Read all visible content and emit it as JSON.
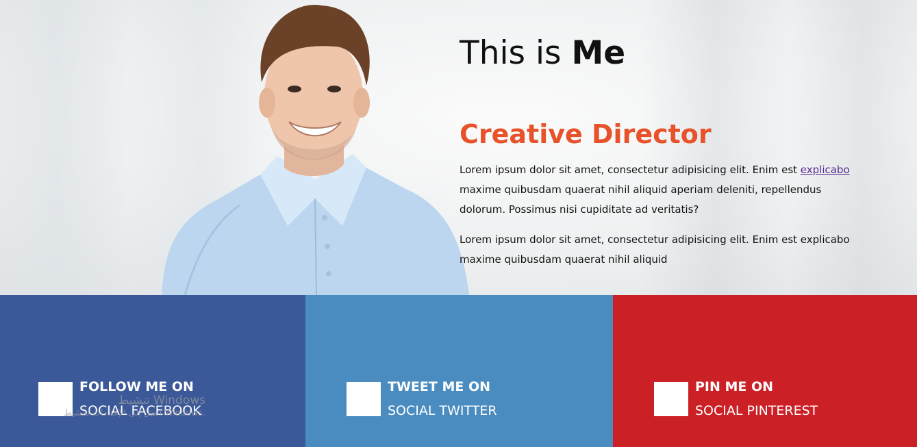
{
  "hero": {
    "title_prefix": "This is ",
    "title_bold": "Me",
    "role": "Creative Director",
    "para1_start": "Lorem ipsum dolor sit amet, consectetur adipisicing elit. Enim est ",
    "para1_link": "explicabo",
    "para1_end": " maxime quibusdam quaerat nihil aliquid aperiam deleniti, repellendus dolorum. Possimus nisi cupiditate ad veritatis?",
    "para2": "Lorem ipsum dolor sit amet, consectetur adipisicing elit. Enim est explicabo maxime quibusdam quaerat nihil aliquid"
  },
  "social": [
    {
      "line1": "FOLLOW ME ON",
      "line2": "SOCIAL FACEBOOK",
      "color": "#3b5998"
    },
    {
      "line1": "TWEET ME ON",
      "line2": "SOCIAL TWITTER",
      "color": "#4a8cc0"
    },
    {
      "line1": "PIN ME ON",
      "line2": "SOCIAL PINTEREST",
      "color": "#cc2027"
    }
  ],
  "watermark": {
    "line1": "تنشيط Windows",
    "line2": "انتقل إلى الإعدادات لتنشيط Windows."
  },
  "colors": {
    "accent": "#e8522a",
    "link": "#5a2d91"
  }
}
